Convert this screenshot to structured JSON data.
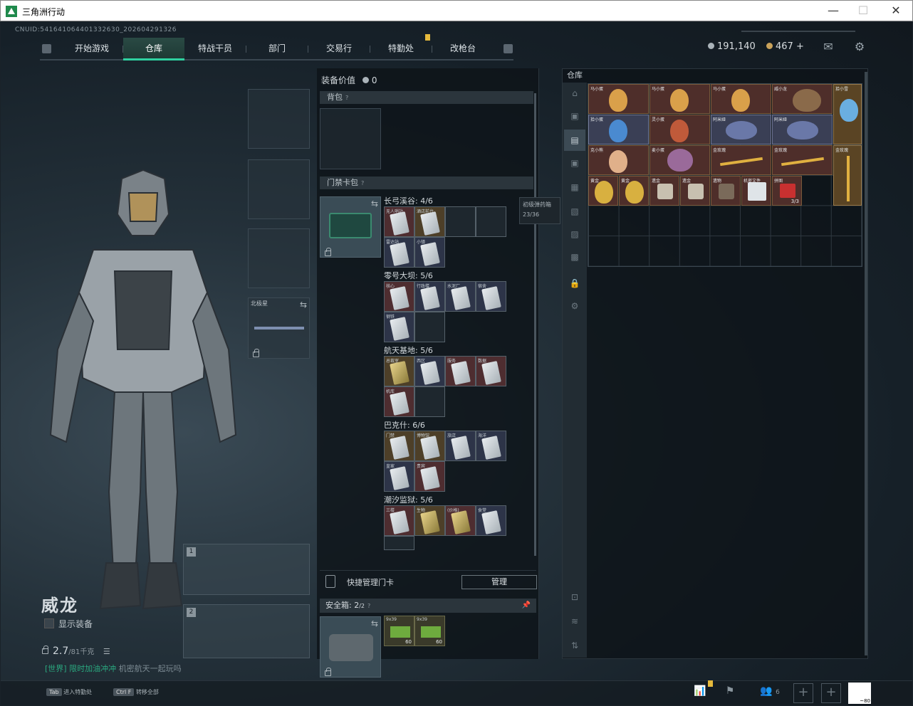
{
  "window": {
    "title": "三角洲行动"
  },
  "header": {
    "uid": "CNUID:541641064401332630_202604291326"
  },
  "nav": {
    "tabs": [
      {
        "label": "开始游戏",
        "active": false
      },
      {
        "label": "仓库",
        "active": true
      },
      {
        "label": "特战干员",
        "active": false
      },
      {
        "label": "部门",
        "active": false
      },
      {
        "label": "交易行",
        "active": false
      },
      {
        "label": "特勤处",
        "active": false
      },
      {
        "label": "改枪台",
        "active": false
      }
    ]
  },
  "currency": {
    "silver": "191,140",
    "gold": "467"
  },
  "operator": {
    "name": "威龙",
    "show_gear_label": "显示装备",
    "weight_value": "2.7",
    "weight_capacity": "/81千克",
    "melee_label": "北极星"
  },
  "announce": {
    "tag": "[世界]",
    "highlight": "限时加油冲冲",
    "text": "机密航天一起玩吗"
  },
  "equipment": {
    "value_label": "装备价值",
    "value": "0",
    "backpack_label": "背包",
    "keycard_label": "门禁卡包",
    "tooltip_title": "初级弹药箱",
    "tooltip_count": "23/36",
    "maps": [
      {
        "title": "长弓溪谷: 4/6",
        "cells": [
          {
            "label": "无人哨站",
            "color": "red",
            "card": "white"
          },
          {
            "label": "酒店前台",
            "color": "gold",
            "card": "white"
          },
          {
            "label": "",
            "color": "empty"
          },
          {
            "label": "",
            "color": "empty"
          },
          {
            "label": "雷达站",
            "color": "blue",
            "card": "white"
          },
          {
            "label": "小镇",
            "color": "blue",
            "card": "white"
          }
        ]
      },
      {
        "title": "零号大坝: 5/6",
        "cells": [
          {
            "label": "核心",
            "color": "red",
            "card": "white"
          },
          {
            "label": "行政楼",
            "color": "blue",
            "card": "white"
          },
          {
            "label": "水泥厂",
            "color": "blue",
            "card": "white"
          },
          {
            "label": "宿舍",
            "color": "blue",
            "card": "white"
          },
          {
            "label": "钢铁",
            "color": "blue",
            "card": "white"
          },
          {
            "label": "",
            "color": "empty"
          }
        ]
      },
      {
        "title": "航天基地: 5/6",
        "cells": [
          {
            "label": "总裁室",
            "color": "gold",
            "card": "yellow"
          },
          {
            "label": "西区",
            "color": "blue",
            "card": "white"
          },
          {
            "label": "服务",
            "color": "red",
            "card": "white"
          },
          {
            "label": "数据",
            "color": "red",
            "card": "white"
          },
          {
            "label": "机库",
            "color": "red",
            "card": "white"
          },
          {
            "label": "",
            "color": "empty"
          }
        ]
      },
      {
        "title": "巴克什: 6/6",
        "cells": [
          {
            "label": "门禁",
            "color": "gold",
            "card": "white"
          },
          {
            "label": "博物馆",
            "color": "gold",
            "card": "white"
          },
          {
            "label": "旅店",
            "color": "blue",
            "card": "white"
          },
          {
            "label": "海洋",
            "color": "blue",
            "card": "white"
          },
          {
            "label": "皇家",
            "color": "blue",
            "card": "white"
          },
          {
            "label": "贵宾",
            "color": "red",
            "card": "white"
          }
        ]
      },
      {
        "title": "潮汐监狱: 5/6",
        "cells": [
          {
            "label": "三楼",
            "color": "red",
            "card": "white"
          },
          {
            "label": "生物",
            "color": "gold",
            "card": "yellow"
          },
          {
            "label": "(价格)",
            "color": "red",
            "card": "yellow"
          },
          {
            "label": "食堂",
            "color": "blue",
            "card": "white"
          }
        ]
      }
    ],
    "quick_manage_label": "快捷管理门卡",
    "manage_button": "管理",
    "safebox_label": "安全箱: 2",
    "safebox_count": "/2",
    "ammo": [
      {
        "label": "9x39",
        "count": "60"
      },
      {
        "label": "9x39",
        "count": "60"
      }
    ]
  },
  "warehouse": {
    "title": "仓库",
    "items": [
      {
        "label": "马小蛋",
        "n": ""
      },
      {
        "label": "马小蛋",
        "n": ""
      },
      {
        "label": "马小蛋",
        "n": ""
      },
      {
        "label": "威小龙",
        "n": ""
      },
      {
        "label": "拾小雪",
        "n": ""
      },
      {
        "label": "拾小蛋",
        "n": ""
      },
      {
        "label": "灵小蛋",
        "n": ""
      },
      {
        "label": "阿米娅",
        "n": ""
      },
      {
        "label": "阿米娅",
        "n": ""
      },
      {
        "label": "克小熊",
        "n": ""
      },
      {
        "label": "麦小蛋",
        "n": ""
      },
      {
        "label": "金玫瑰",
        "n": ""
      },
      {
        "label": "金玫瑰",
        "n": ""
      },
      {
        "label": "金玫瑰",
        "n": ""
      },
      {
        "label": "黄金",
        "n": ""
      },
      {
        "label": "黄金",
        "n": ""
      },
      {
        "label": "遗金",
        "n": ""
      },
      {
        "label": "遗金",
        "n": ""
      },
      {
        "label": "遗物",
        "n": ""
      },
      {
        "label": "机密文件",
        "n": ""
      },
      {
        "label": "拼图",
        "n": "3/3"
      }
    ]
  },
  "footer": {
    "hint1_key": "Tab",
    "hint1_text": "进入特勤处",
    "hint2_key": "Ctrl F",
    "hint2_text": "转移全部",
    "friends_count": "6",
    "avatar_text": "~80"
  },
  "colors": {
    "accent": "#2fd1a0",
    "badge": "#e6b93c"
  }
}
